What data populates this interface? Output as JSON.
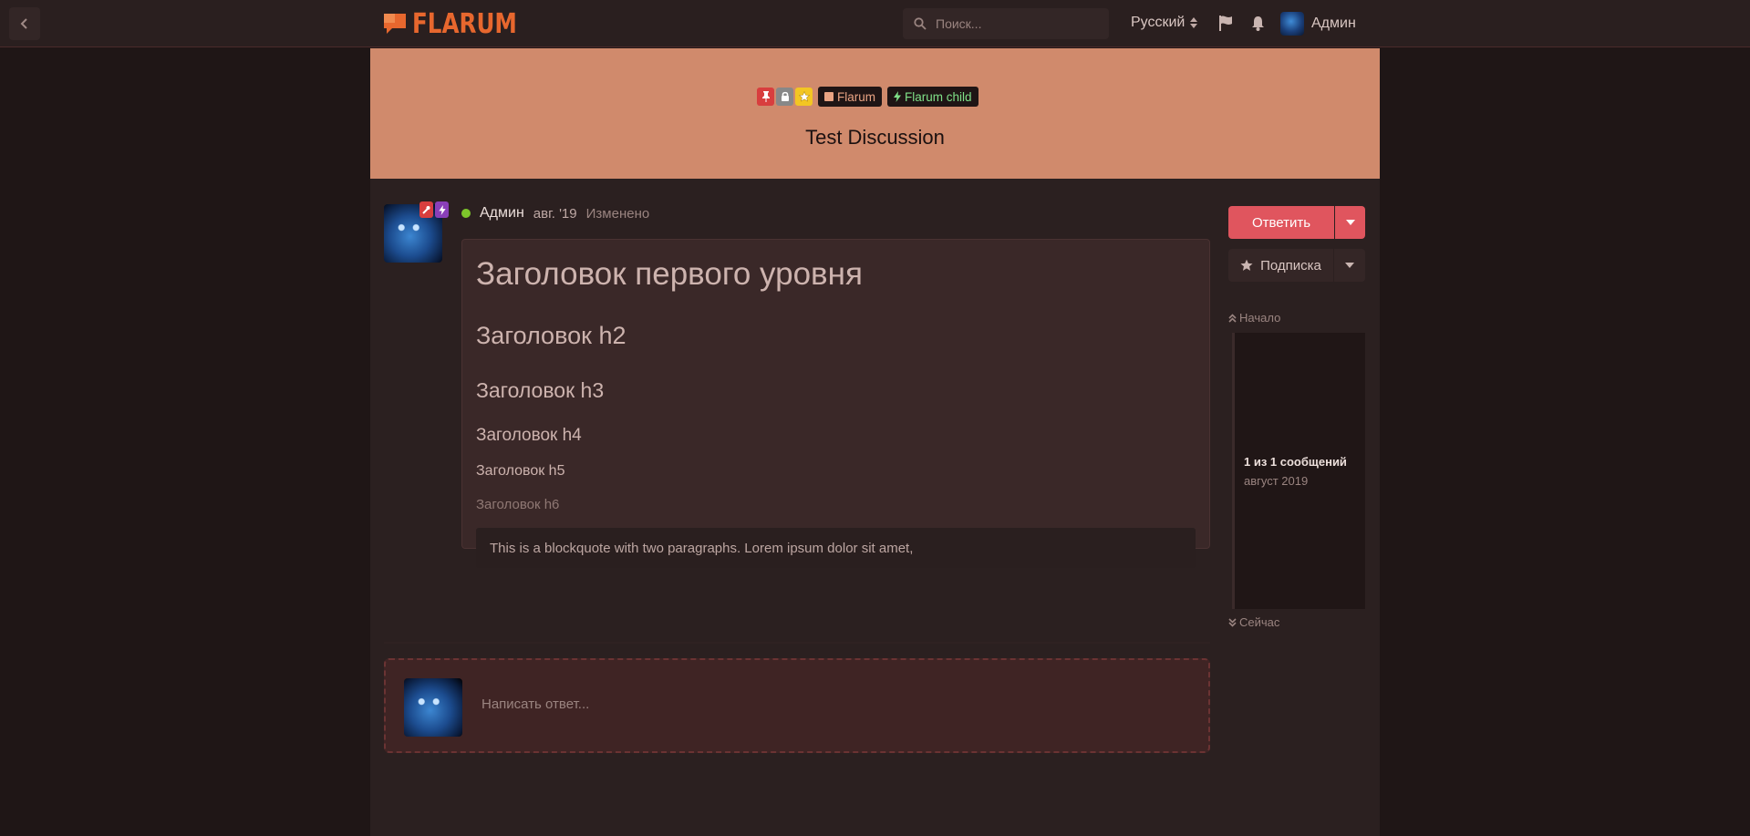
{
  "header": {
    "logo_text": "FLARUM",
    "search_placeholder": "Поиск...",
    "language": "Русский",
    "username": "Админ"
  },
  "discussion": {
    "title": "Test Discussion",
    "tags": [
      {
        "label": "Flarum",
        "color": "#e9a383"
      },
      {
        "label": "Flarum child",
        "color": "#7fe088"
      }
    ],
    "badges": [
      {
        "icon": "thumbtack-icon",
        "color": "#d83e3e"
      },
      {
        "icon": "lock-icon",
        "color": "#888888"
      },
      {
        "icon": "star-icon",
        "color": "#f3c623"
      }
    ]
  },
  "post": {
    "author": "Админ",
    "date": "авг. '19",
    "edited": "Изменено",
    "h1": "Заголовок первого уровня",
    "h2": "Заголовок h2",
    "h3": "Заголовок h3",
    "h4": "Заголовок h4",
    "h5": "Заголовок h5",
    "h6": "Заголовок h6",
    "blockquote": "This is a blockquote with two paragraphs. Lorem ipsum dolor sit amet,"
  },
  "composer": {
    "placeholder": "Написать ответ..."
  },
  "sidebar": {
    "reply_label": "Ответить",
    "follow_label": "Подписка",
    "scrubber_top": "Начало",
    "scrubber_count": "1 из 1 сообщений",
    "scrubber_date": "август 2019",
    "scrubber_bottom": "Сейчас"
  },
  "colors": {
    "accent": "#e7672e",
    "hero": "#d08a6c",
    "primary_button": "#e0555e"
  }
}
